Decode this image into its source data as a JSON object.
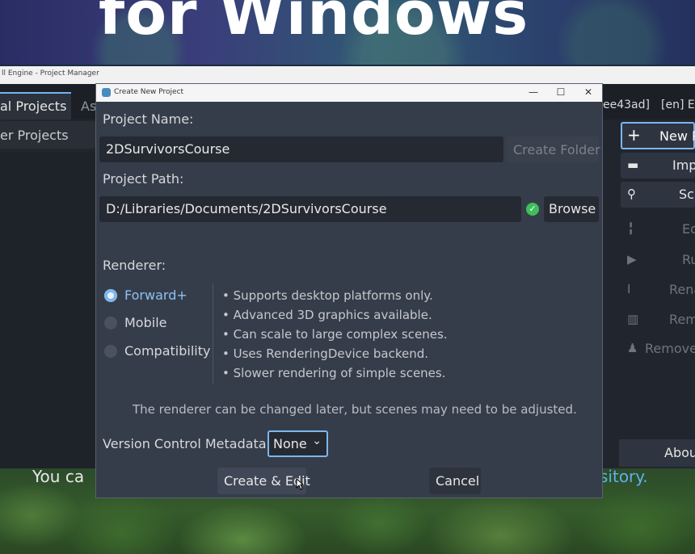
{
  "banner": {
    "text": "for Windows"
  },
  "background_text": {
    "left": "You ca",
    "right": "sitory."
  },
  "project_manager": {
    "window_title": "ll Engine - Project Manager",
    "tabs": [
      "al Projects",
      "As"
    ],
    "version_hash": "ee43ad]",
    "language": "[en] E",
    "filter_placeholder": "er Projects",
    "side_buttons": [
      {
        "icon": "plus-icon",
        "label": "New P",
        "enabled": true
      },
      {
        "icon": "folder-icon",
        "label": "Imp",
        "enabled": true
      },
      {
        "icon": "search-icon",
        "label": "Sca",
        "enabled": true
      },
      {
        "icon": "edit-icon",
        "label": "Ed",
        "enabled": false
      },
      {
        "icon": "play-icon",
        "label": "Ru",
        "enabled": false
      },
      {
        "icon": "rename-icon",
        "label": "Rena",
        "enabled": false
      },
      {
        "icon": "trash-icon",
        "label": "Rem",
        "enabled": false
      },
      {
        "icon": "broom-icon",
        "label": "Remove",
        "enabled": false
      }
    ],
    "about_label": "Abou"
  },
  "dialog": {
    "title": "Create New Project",
    "controls": {
      "minimize": "—",
      "maximize": "☐",
      "close": "✕"
    },
    "project_name_label": "Project Name:",
    "project_name_value": "2DSurvivorsCourse",
    "create_folder_label": "Create Folder",
    "project_path_label": "Project Path:",
    "project_path_value": "D:/Libraries/Documents/2DSurvivorsCourse",
    "browse_label": "Browse",
    "path_valid_icon": "check-circle-icon",
    "renderer_label": "Renderer:",
    "renderers": [
      {
        "label": "Forward+",
        "selected": true
      },
      {
        "label": "Mobile",
        "selected": false
      },
      {
        "label": "Compatibility",
        "selected": false
      }
    ],
    "renderer_notes": [
      "Supports desktop platforms only.",
      "Advanced 3D graphics available.",
      "Can scale to large complex scenes.",
      "Uses RenderingDevice backend.",
      "Slower rendering of simple scenes."
    ],
    "renderer_hint": "The renderer can be changed later, but scenes may need to be adjusted.",
    "vcs_label": "Version Control Metadata:",
    "vcs_value": "None",
    "create_button": "Create & Edit",
    "cancel_button": "Cancel"
  },
  "colors": {
    "accent": "#7eb6ee",
    "selected_renderer": "#8cc2f5",
    "valid_check": "#3fbf5a"
  }
}
